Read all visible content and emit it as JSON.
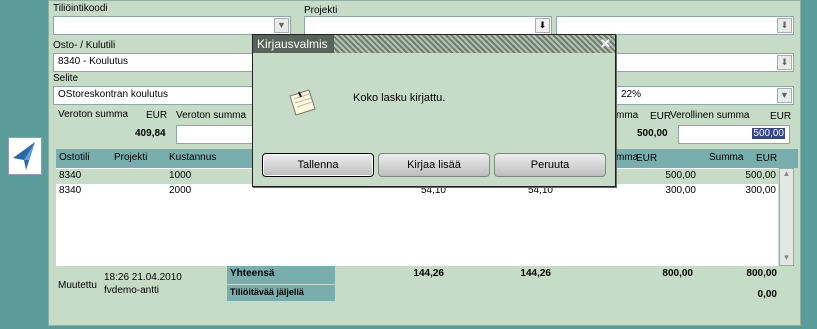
{
  "form": {
    "account_code_label": "Tiliöintikoodi",
    "project_label": "Projekti",
    "purchase_account_label": "Osto- / Kulutili",
    "purchase_account_value": "8340 - Koulutus",
    "description_label": "Selite",
    "description_value": "OStoreskontran koulutus",
    "vat_rate_value": "22%",
    "net_amount_label": "Veroton summa",
    "net_currency": "EUR",
    "net_amount_value": "409,84",
    "net_amount2_label": "Veroton summa",
    "right_summa_partial": "mma",
    "right_currency": "EUR",
    "right_amount_value": "500,00",
    "gross_amount_label": "Verollinen summa",
    "gross_currency": "EUR",
    "gross_amount_value": "500,00"
  },
  "grid": {
    "headers": {
      "ostotili": "Ostotili",
      "projekti": "Projekti",
      "kustannus": "Kustannus",
      "mma": "mma",
      "eur1": "EUR",
      "summa": "Summa",
      "eur2": "EUR"
    },
    "rows": [
      {
        "account": "8340",
        "cost": "1000",
        "c1": "",
        "c2": "",
        "c3": "500,00",
        "c4": "500,00"
      },
      {
        "account": "8340",
        "cost": "2000",
        "c1": "54,10",
        "c2": "54,10",
        "c3": "300,00",
        "c4": "300,00"
      }
    ],
    "modified_label": "Muutettu",
    "modified_time": "18:26 21.04.2010",
    "modified_user": "fvdemo-antti",
    "total_label": "Yhteensä",
    "remaining_label": "Tiliöitävää jäljellä",
    "totals": [
      "144,26",
      "144,26",
      "800,00",
      "800,00"
    ],
    "remaining_value": "0,00"
  },
  "dialog": {
    "title": "Kirjausvalmis",
    "message": "Koko lasku kirjattu.",
    "buttons": {
      "save": "Tallenna",
      "post_more": "Kirjaa lisää",
      "cancel": "Peruuta"
    },
    "icon": "note-icon"
  }
}
